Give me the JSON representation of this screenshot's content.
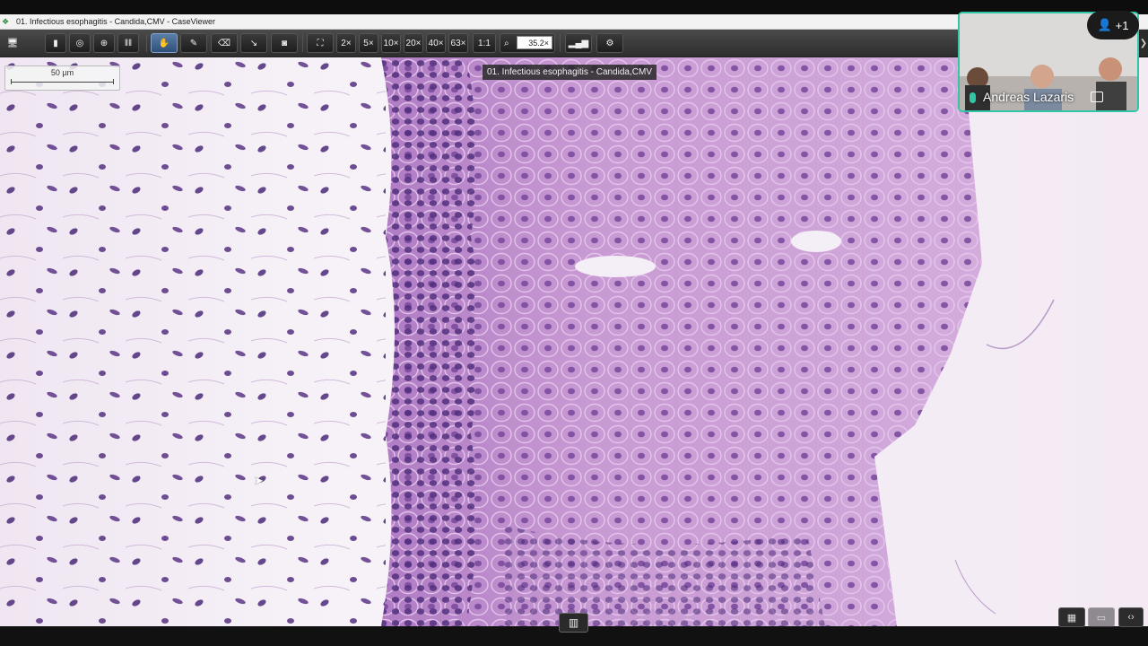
{
  "window": {
    "title": "01. Infectious esophagitis - Candida,CMV - CaseViewer"
  },
  "toolbar": {
    "buttons": [
      {
        "name": "monitor-icon",
        "glyph": "🖥"
      },
      {
        "name": "slide-icon",
        "glyph": "▮"
      },
      {
        "name": "compass-icon",
        "glyph": "◎"
      },
      {
        "name": "magnifier-icon",
        "glyph": "⊕"
      },
      {
        "name": "barcode-icon",
        "glyph": "|||"
      },
      {
        "name": "pan-hand-icon",
        "glyph": "✋"
      },
      {
        "name": "pen-annotation-icon",
        "glyph": "✎"
      },
      {
        "name": "eraser-icon",
        "glyph": "⌫"
      },
      {
        "name": "measure-icon",
        "glyph": "↘"
      },
      {
        "name": "camera-icon",
        "glyph": "📷"
      },
      {
        "name": "fit-screen-icon",
        "glyph": "⛶"
      }
    ],
    "zoom_presets": [
      "2×",
      "5×",
      "10×",
      "20×",
      "40×",
      "63×",
      "1:1"
    ],
    "zoom_value": "35.2×",
    "histogram_icon": "bar-chart-icon",
    "extra_icon": "settings-icon"
  },
  "viewer": {
    "scale_label": "50 µm",
    "slide_label": "01. Infectious esophagitis - Candida,CMV"
  },
  "video": {
    "participant_name": "Andreas Lazaris",
    "plus_count": "+1"
  },
  "colors": {
    "accent": "#2fc7a6",
    "tissue_epithelium": "#c79ad2",
    "tissue_stroma": "#f3eef5",
    "nuclei": "#4b2a79"
  }
}
